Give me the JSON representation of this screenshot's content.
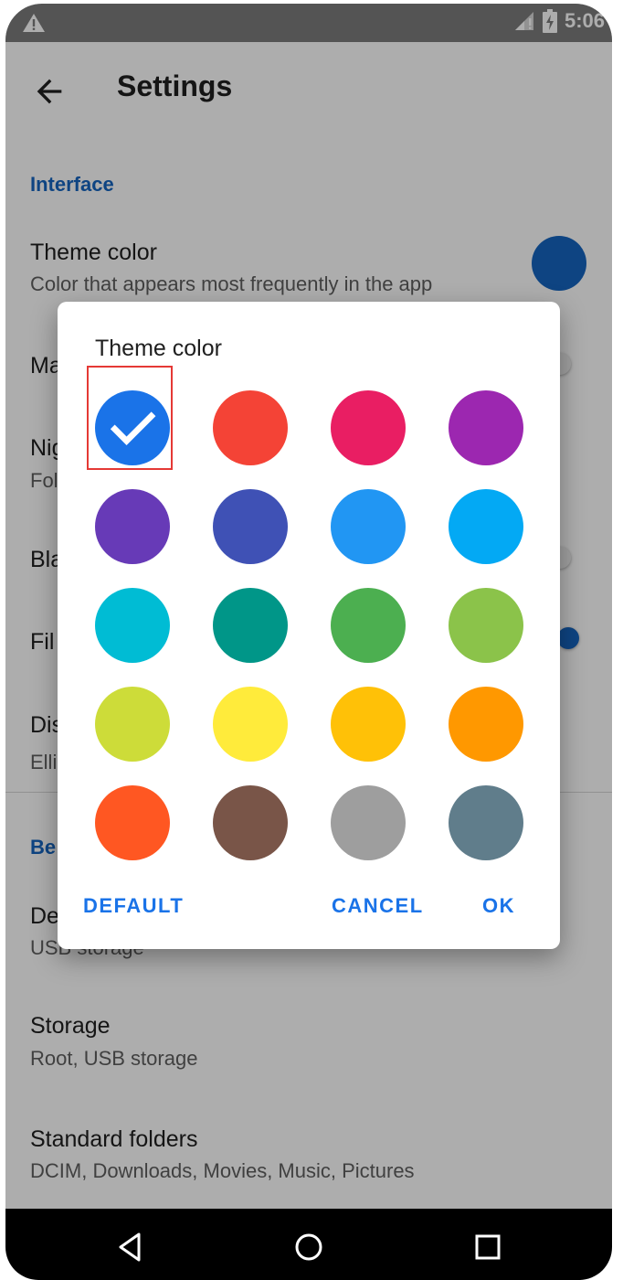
{
  "status_bar": {
    "time": "5:06",
    "icons": [
      "warning-icon",
      "signal-icon",
      "battery-charging-icon"
    ]
  },
  "appbar": {
    "title": "Settings",
    "back_icon": "arrow-back-icon"
  },
  "settings": {
    "interface_header": "Interface",
    "theme_color": {
      "title": "Theme color",
      "summary": "Color that appears most frequently in the app",
      "current_color": "#1565c0"
    },
    "row2_partial_title": "Ma",
    "row3_partial_title": "Nig",
    "row3_partial_summary": "Fol",
    "row4_partial_title": "Bla",
    "row5_partial_title": "Fil",
    "row6_partial_title": "Dis",
    "row6_partial_summary": "Elli",
    "behavior_partial_header": "Be",
    "row7_partial_title": "De",
    "row7_partial_summary": "USB storage",
    "storage": {
      "title": "Storage",
      "summary": "Root, USB storage"
    },
    "standard_folders": {
      "title": "Standard folders",
      "summary": "DCIM, Downloads, Movies, Music, Pictures"
    }
  },
  "dialog": {
    "title": "Theme color",
    "selected_index": 0,
    "colors": [
      "#1a73e8",
      "#f44336",
      "#e91e63",
      "#9c27b0",
      "#673ab7",
      "#3f51b5",
      "#2196f3",
      "#03a9f4",
      "#00bcd4",
      "#009688",
      "#4caf50",
      "#8bc34a",
      "#cddc39",
      "#ffeb3b",
      "#ffc107",
      "#ff9800",
      "#ff5722",
      "#795548",
      "#9e9e9e",
      "#607d8b"
    ],
    "buttons": {
      "default": "DEFAULT",
      "cancel": "CANCEL",
      "ok": "OK"
    }
  },
  "navbar": {
    "icons": [
      "back-triangle-icon",
      "home-circle-icon",
      "recents-square-icon"
    ]
  }
}
